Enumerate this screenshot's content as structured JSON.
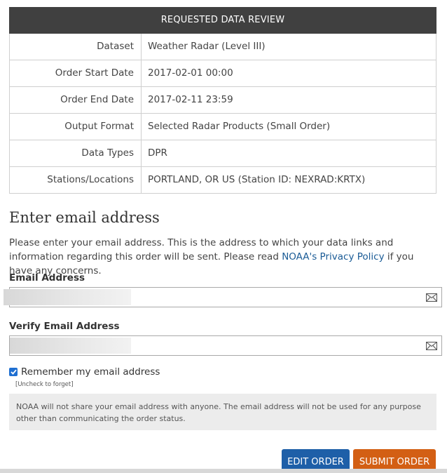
{
  "review": {
    "title": "REQUESTED DATA REVIEW",
    "rows": [
      {
        "label": "Dataset",
        "value": "Weather Radar (Level III)"
      },
      {
        "label": "Order Start Date",
        "value": "2017-02-01 00:00"
      },
      {
        "label": "Order End Date",
        "value": "2017-02-11 23:59"
      },
      {
        "label": "Output Format",
        "value": "Selected Radar Products (Small Order)"
      },
      {
        "label": "Data Types",
        "value": "DPR"
      },
      {
        "label": "Stations/Locations",
        "value": "PORTLAND, OR US (Station ID: NEXRAD:KRTX)"
      }
    ]
  },
  "email_section": {
    "title": "Enter email address",
    "intro_before": "Please enter your email address. This is the address to which your data links and information regarding this order will be sent. Please read ",
    "privacy_link": "NOAA's Privacy Policy",
    "intro_after": " if you have any concerns.",
    "email_label": "Email Address",
    "verify_label": "Verify Email Address",
    "remember_label": "Remember my email address",
    "remember_checked": true,
    "uncheck_hint": "[Uncheck to forget]",
    "notice": "NOAA will not share your email address with anyone. The email address will not be used for any purpose other than communicating the order status."
  },
  "buttons": {
    "edit": "EDIT ORDER",
    "submit": "SUBMIT ORDER"
  },
  "icons": {
    "email_field": "envelope-icon",
    "checkbox": "checkmark-icon"
  },
  "colors": {
    "header_bg": "#404040",
    "link": "#1a5b96",
    "edit_button": "#1e5fa8",
    "submit_button": "#d35f14",
    "checkbox": "#1f6fd1"
  }
}
